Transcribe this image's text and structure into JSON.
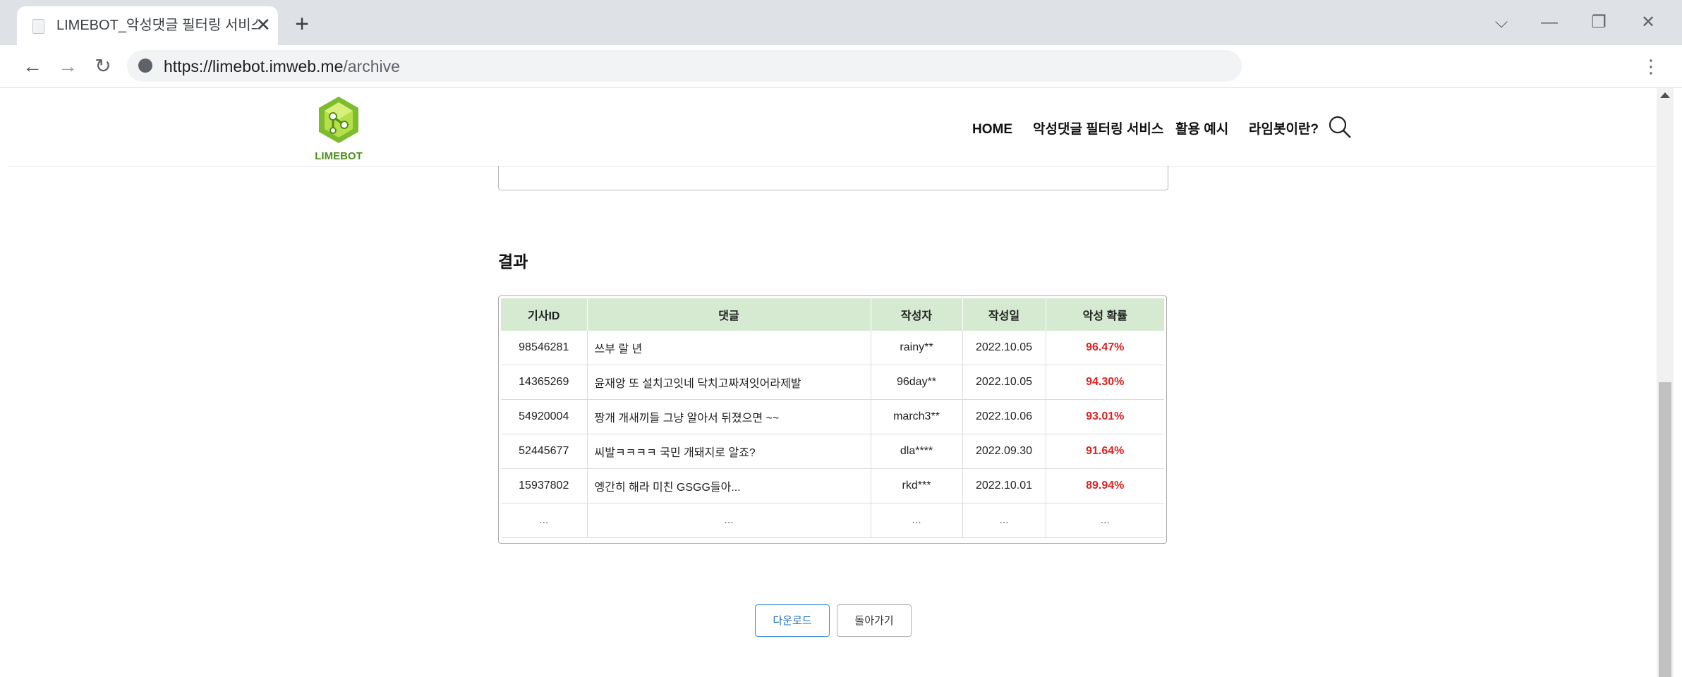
{
  "browser": {
    "tab_title": "LIMEBOT_악성댓글 필터링 서비스",
    "new_tab": "+",
    "close": "✕",
    "url_host": "https://limebot.imweb.me",
    "url_path": "/archive",
    "back": "←",
    "forward": "→",
    "reload": "↻",
    "menu": "⋮",
    "win_dropdown": "⌵",
    "win_minimize": "—",
    "win_restore": "❐",
    "win_close": "✕"
  },
  "site": {
    "logo_text": "LIMEBOT",
    "brand_color": "#8cc63f",
    "nav": [
      {
        "label": "HOME"
      },
      {
        "label": "악성댓글 필터링 서비스"
      },
      {
        "label": "활용 예시"
      },
      {
        "label": "라임봇이란?"
      }
    ]
  },
  "main": {
    "result_title": "결과",
    "table": {
      "headers": [
        "기사ID",
        "댓글",
        "작성자",
        "작성일",
        "악성 확률"
      ],
      "rows": [
        [
          "98546281",
          "쓰부 랄 년",
          "rainy**",
          "2022.10.05",
          "96.47%"
        ],
        [
          "14365269",
          "윤재앙 또 설치고잇네 닥치고짜져잇어라제발",
          "96day**",
          "2022.10.05",
          "94.30%"
        ],
        [
          "54920004",
          "짱개 개새끼들 그냥 알아서 뒤졌으면 ~~",
          "march3**",
          "2022.10.06",
          "93.01%"
        ],
        [
          "52445677",
          "씨발ㅋㅋㅋㅋ 국민 개돼지로 알죠?",
          "dla****",
          "2022.09.30",
          "91.64%"
        ],
        [
          "15937802",
          "엥간히 해라 미친 GSGG들아...",
          "rkd***",
          "2022.10.01",
          "89.94%"
        ],
        [
          "...",
          "...",
          "...",
          "...",
          "..."
        ]
      ]
    },
    "download_label": "다운로드",
    "back_label": "돌아가기"
  }
}
